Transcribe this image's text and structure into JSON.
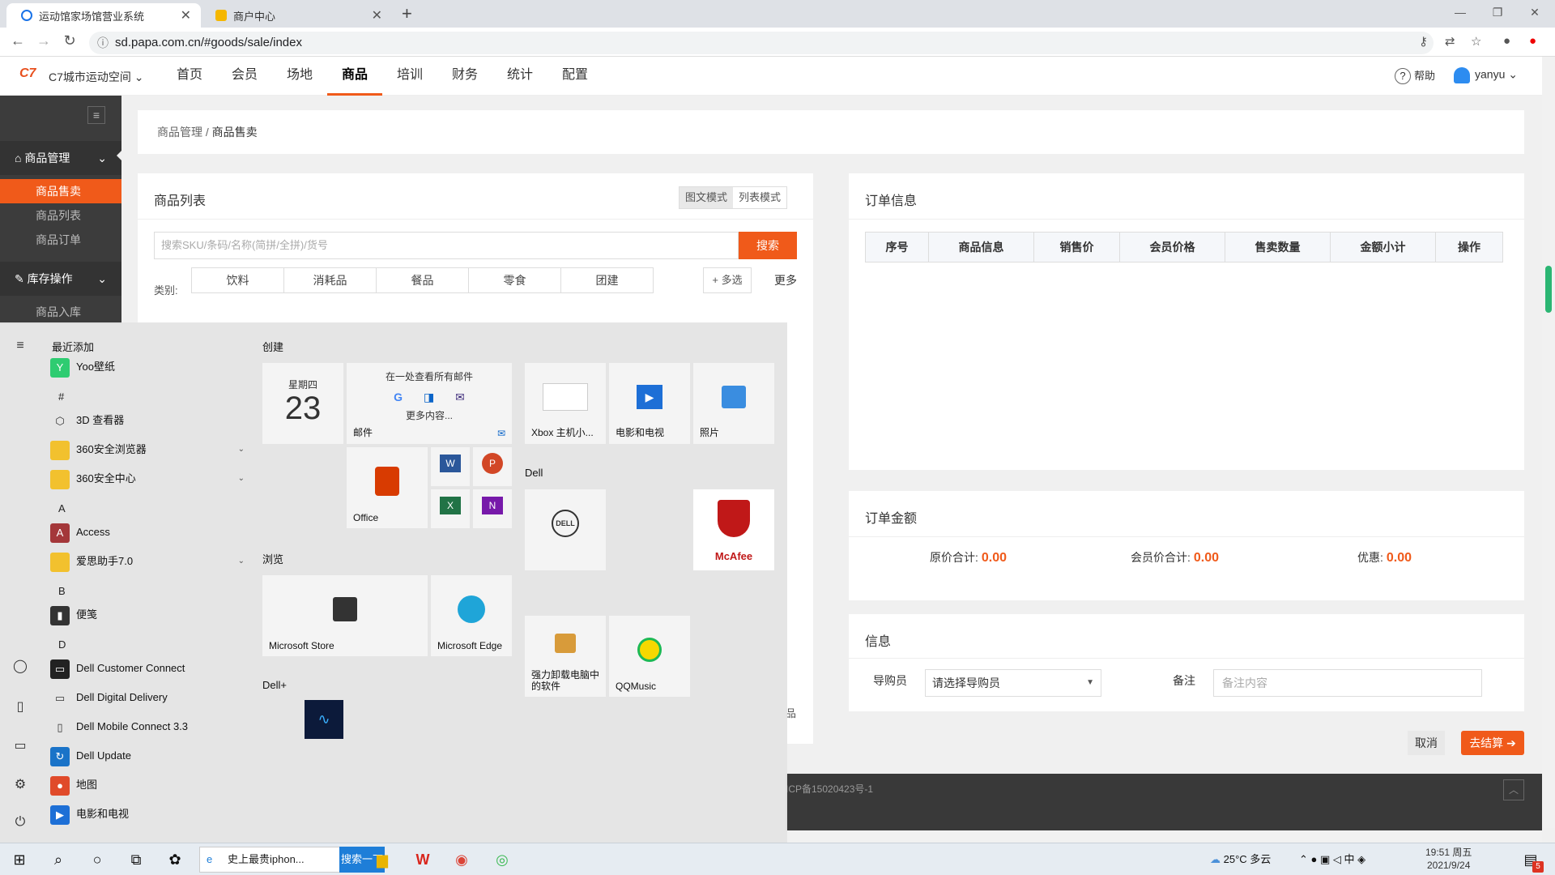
{
  "browser": {
    "tabs": [
      {
        "title": "运动馆家场馆营业系统",
        "active": true
      },
      {
        "title": "商户中心",
        "active": false
      }
    ],
    "url": "sd.papa.com.cn/#goods/sale/index"
  },
  "header": {
    "venue": "C7城市运动空间",
    "nav": [
      "首页",
      "会员",
      "场地",
      "商品",
      "培训",
      "财务",
      "统计",
      "配置"
    ],
    "active_nav": "商品",
    "help": "帮助",
    "user": "yanyu"
  },
  "sidebar": {
    "groups": [
      {
        "label": "商品管理",
        "items": [
          "商品售卖",
          "商品列表",
          "商品订单"
        ]
      },
      {
        "label": "库存操作",
        "items": [
          "商品入库"
        ]
      }
    ],
    "active_item": "商品售卖"
  },
  "breadcrumb": {
    "parent": "商品管理",
    "current": "商品售卖"
  },
  "goods": {
    "title": "商品列表",
    "modes": [
      "图文模式",
      "列表模式"
    ],
    "search_placeholder": "搜索SKU/条码/名称(简拼/全拼)/货号",
    "search_button": "搜索",
    "category_label": "类别:",
    "categories": [
      "饮料",
      "消耗品",
      "餐品",
      "零食",
      "团建"
    ],
    "multi_select": "+ 多选",
    "more": "更多"
  },
  "order": {
    "title": "订单信息",
    "columns": [
      "序号",
      "商品信息",
      "销售价",
      "会员价格",
      "售卖数量",
      "金额小计",
      "操作"
    ]
  },
  "amount": {
    "title": "订单金额",
    "original_label": "原价合计:",
    "original_value": "0.00",
    "member_label": "会员价合计:",
    "member_value": "0.00",
    "discount_label": "优惠:",
    "discount_value": "0.00"
  },
  "info": {
    "title": "信息",
    "guide_label": "导购员",
    "guide_select": "请选择导购员",
    "remark_label": "备注",
    "remark_placeholder": "备注内容"
  },
  "actions": {
    "cancel": "取消",
    "checkout": "去结算"
  },
  "footer": {
    "icp": "ICP备15020423号-1",
    "fragment": "品"
  },
  "startmenu": {
    "recent_header": "最近添加",
    "apps": [
      {
        "name": "Yoo壁纸",
        "icon": "yoo-icon"
      },
      {
        "letter": "#"
      },
      {
        "name": "3D 查看器",
        "icon": "cube-icon"
      },
      {
        "name": "360安全浏览器",
        "icon": "folder-icon",
        "expand": true
      },
      {
        "name": "360安全中心",
        "icon": "folder-icon",
        "expand": true
      },
      {
        "letter": "A"
      },
      {
        "name": "Access",
        "icon": "access-icon"
      },
      {
        "name": "爱思助手7.0",
        "icon": "folder-icon",
        "expand": true
      },
      {
        "letter": "B"
      },
      {
        "name": "便笺",
        "icon": "sticky-notes-icon"
      },
      {
        "letter": "D"
      },
      {
        "name": "Dell Customer Connect",
        "icon": "chat-icon"
      },
      {
        "name": "Dell Digital Delivery",
        "icon": "delivery-icon"
      },
      {
        "name": "Dell Mobile Connect 3.3",
        "icon": "phone-icon"
      },
      {
        "name": "Dell Update",
        "icon": "update-icon"
      },
      {
        "name": "地图",
        "icon": "map-pin-icon"
      },
      {
        "name": "电影和电视",
        "icon": "film-icon"
      }
    ],
    "groups": {
      "create": "创建",
      "browse": "浏览",
      "dell": "Dell",
      "dellplus": "Dell+"
    },
    "tiles": {
      "calendar_day": "星期四",
      "calendar_date": "23",
      "mail_header": "在一处查看所有邮件",
      "mail_more": "更多内容...",
      "mail": "邮件",
      "office": "Office",
      "xbox": "Xbox 主机小...",
      "movies": "电影和电视",
      "photos": "照片",
      "store": "Microsoft Store",
      "edge": "Microsoft Edge",
      "uninstall": "强力卸载电脑中的软件",
      "qqmusic": "QQMusic",
      "mcafee": "McAfee",
      "dell_logo": "DELL"
    }
  },
  "taskbar": {
    "search_text": "史上最贵iphon...",
    "search_button": "搜索一下",
    "weather": "25°C 多云",
    "time": "19:51 周五",
    "date": "2021/9/24",
    "notifications": "5"
  },
  "colors": {
    "accent": "#f05a1a",
    "sidebar": "#3c3c3c",
    "taskbar_blue": "#1e7ed8"
  }
}
